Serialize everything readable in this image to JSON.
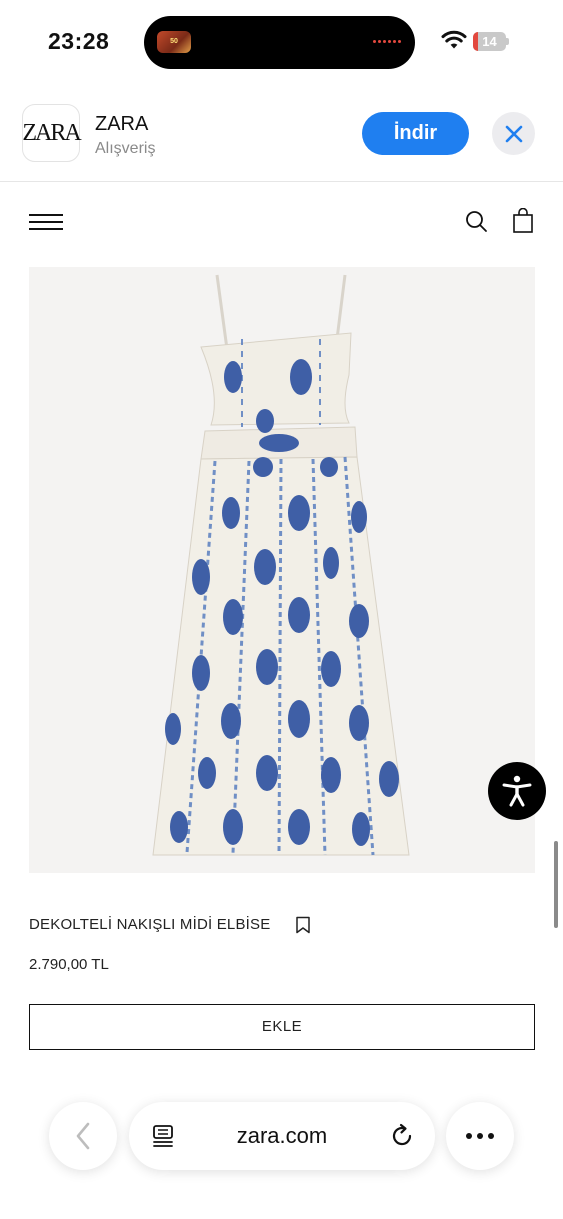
{
  "status_bar": {
    "time": "23:28",
    "island_thumb_text": "50 BÖLÜM",
    "battery_level": "14",
    "battery_fraction": 0.14,
    "icons": [
      "wifi-icon",
      "battery-icon"
    ]
  },
  "app_banner": {
    "icon_text": "ZARA",
    "name": "ZARA",
    "category": "Alışveriş",
    "get_label": "İndir",
    "close_icon": "close-icon",
    "accent_color": "#1f7ff0"
  },
  "site_header": {
    "icons": [
      "menu-icon",
      "search-icon",
      "shopping-bag-icon"
    ]
  },
  "product": {
    "image_alt": "dress-photo",
    "title": "DEKOLTELİ NAKIŞLI MİDİ ELBİSE",
    "price": "2.790,00 TL",
    "add_label": "EKLE",
    "bookmark_icon": "bookmark-icon"
  },
  "floating": {
    "accessibility_icon": "accessibility-icon"
  },
  "browser": {
    "url": "zara.com",
    "icons": [
      "back-icon",
      "reader-icon",
      "reload-icon",
      "more-icon"
    ]
  }
}
